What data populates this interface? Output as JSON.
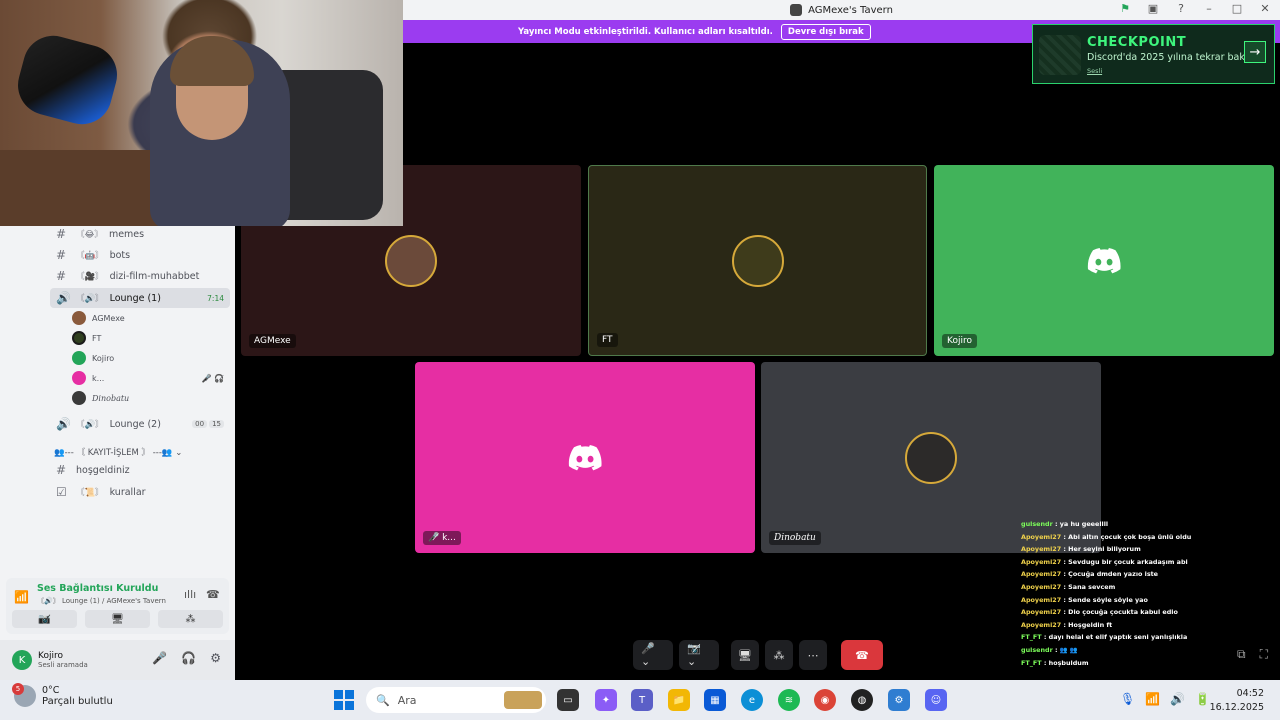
{
  "window": {
    "title": "AGMexe's Tavern"
  },
  "stream_mode": {
    "message": "Yayıncı Modu etkinleştirildi. Kullanıcı adları kısaltıldı.",
    "disable_label": "Devre dışı bırak"
  },
  "checkpoint": {
    "title": "CHECKPOINT",
    "subtitle": "Discord'da 2025 yılına tekrar bak",
    "link": "Sesli",
    "accent": "#3ef57d"
  },
  "sidebar": {
    "channels": [
      {
        "type": "text",
        "emoji": "〘😂〙",
        "label": "memes"
      },
      {
        "type": "text",
        "emoji": "〘🤖〙",
        "label": "bots"
      },
      {
        "type": "text",
        "emoji": "〘🎥〙",
        "label": "dizi-film-muhabbet"
      }
    ],
    "active_voice": {
      "emoji": "〘🔊〙",
      "label": "Lounge (1)",
      "timer": "7:14"
    },
    "members": [
      {
        "name": "AGMexe",
        "color": "#8a5a3c",
        "trail": ""
      },
      {
        "name": "FT",
        "color": "#2f3f1f",
        "trail": ""
      },
      {
        "name": "Kojiro",
        "color": "#23a559",
        "trail": ""
      },
      {
        "name": "k...",
        "color": "#e62ea3",
        "trail": "🎤̸ 🎧̸"
      },
      {
        "name": "Dinobatu",
        "color": "#3a3a3a",
        "trail": ""
      }
    ],
    "voice2": {
      "emoji": "〘🔊〙",
      "label": "Lounge (2)",
      "counts": [
        "00",
        "15"
      ]
    },
    "category": "👥--- 〘 KAYIT-İŞLEM 〙 ---👥",
    "welcome": {
      "label": "hoşgeldiniz"
    },
    "rules": {
      "emoji": "〘📜〙",
      "label": "kurallar"
    },
    "voice_panel": {
      "status": "Ses Bağlantısı Kuruldu",
      "detail": "〘🔊〙 Lounge (1) / AGMexe's Tavern"
    },
    "user": {
      "name": "Kojiro",
      "status": "Sesli aramada",
      "initial": "K"
    }
  },
  "tiles": [
    {
      "name": "AGMexe",
      "bg": "#2c1617",
      "kind": "avatar",
      "avatar_color": "#6b4a3a"
    },
    {
      "name": "FT",
      "bg": "#2a2816",
      "kind": "avatar",
      "avatar_color": "#3e3b1b"
    },
    {
      "name": "Kojiro",
      "bg": "#41b35a",
      "kind": "discord"
    },
    {
      "name": "k...",
      "bg": "#e62ea3",
      "kind": "discord"
    },
    {
      "name": "Dinobatu",
      "bg": "#3b3d42",
      "kind": "avatar",
      "avatar_color": "#2c2a29"
    }
  ],
  "chat": [
    {
      "user": "gulsendr",
      "msg": "ya hu geeellll",
      "green": true
    },
    {
      "user": "Apoyemi27",
      "msg": "Abi altın çocuk çok boşa ünlü oldu",
      "green": false
    },
    {
      "user": "Apoyemi27",
      "msg": "Her seyini biliyorum",
      "green": false
    },
    {
      "user": "Apoyemi27",
      "msg": "Sevdugu bir çocuk arkadaşım abi",
      "green": false
    },
    {
      "user": "Apoyemi27",
      "msg": "Çocuğa dmden yazıo iste",
      "green": false
    },
    {
      "user": "Apoyemi27",
      "msg": "Sana sevcem",
      "green": false
    },
    {
      "user": "Apoyemi27",
      "msg": "Sende söyle söyle yao",
      "green": false
    },
    {
      "user": "Apoyemi27",
      "msg": "Dio çocuğa çocukta kabul edio",
      "green": false
    },
    {
      "user": "Apoyemi27",
      "msg": "Hoşgeldin ft",
      "green": false
    },
    {
      "user": "FT_FT",
      "msg": "dayı helal et elif yaptık seni yanlışlıkla",
      "green": true
    },
    {
      "user": "gulsendr",
      "msg": "👥 👥",
      "green": true
    },
    {
      "user": "FT_FT",
      "msg": "hoşbuldum",
      "green": true
    }
  ],
  "taskbar": {
    "weather_temp": "0°C",
    "weather_desc": "Parçalı bulutlu",
    "weather_badge": "5",
    "search_placeholder": "Ara",
    "time": "04:52",
    "date": "16.12.2025"
  }
}
